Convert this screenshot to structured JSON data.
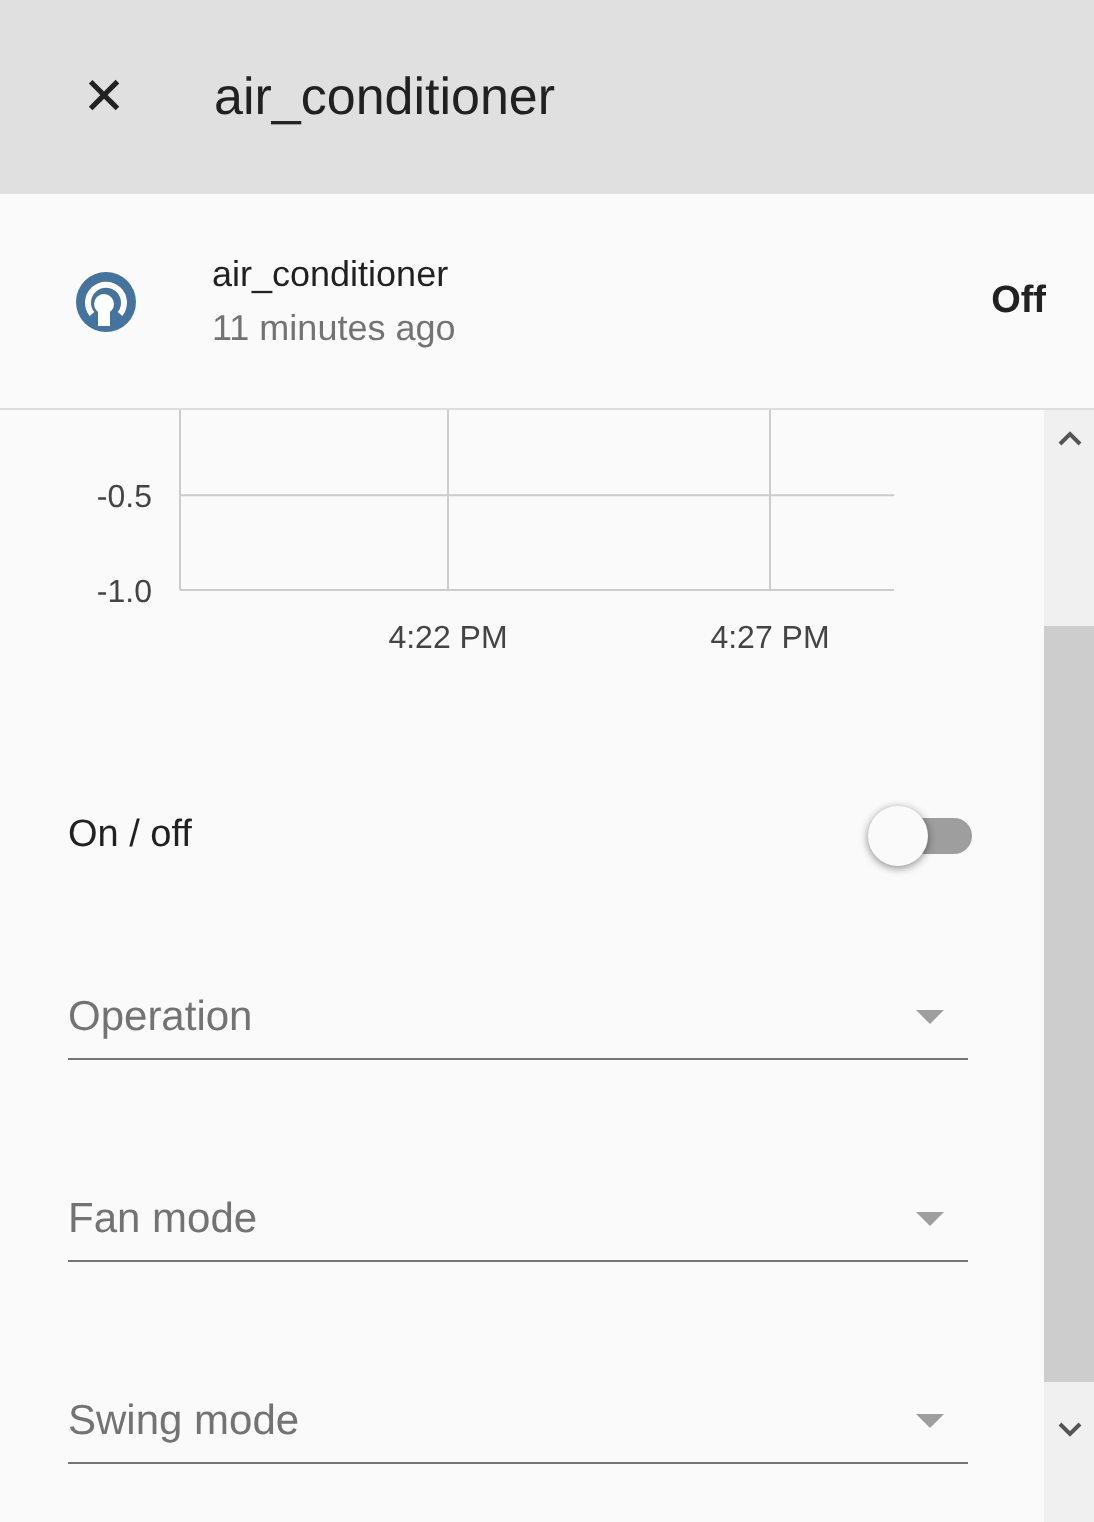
{
  "header": {
    "close_glyph": "✕",
    "title": "air_conditioner"
  },
  "entity": {
    "name": "air_conditioner",
    "last_changed": "11 minutes ago",
    "state": "Off"
  },
  "chart_data": {
    "type": "line",
    "grid": true,
    "yticks": [
      {
        "value": -0.5,
        "label": "-0.5"
      },
      {
        "value": -1.0,
        "label": "-1.0"
      }
    ],
    "ylim": [
      -1.0,
      -0.05
    ],
    "categories": [
      null,
      "4:22 PM",
      "4:27 PM"
    ]
  },
  "controls": [
    {
      "kind": "toggle",
      "label": "On / off",
      "on": false
    },
    {
      "kind": "select",
      "placeholder": "Operation"
    },
    {
      "kind": "select",
      "placeholder": "Fan mode"
    },
    {
      "kind": "select",
      "placeholder": "Swing mode"
    }
  ]
}
